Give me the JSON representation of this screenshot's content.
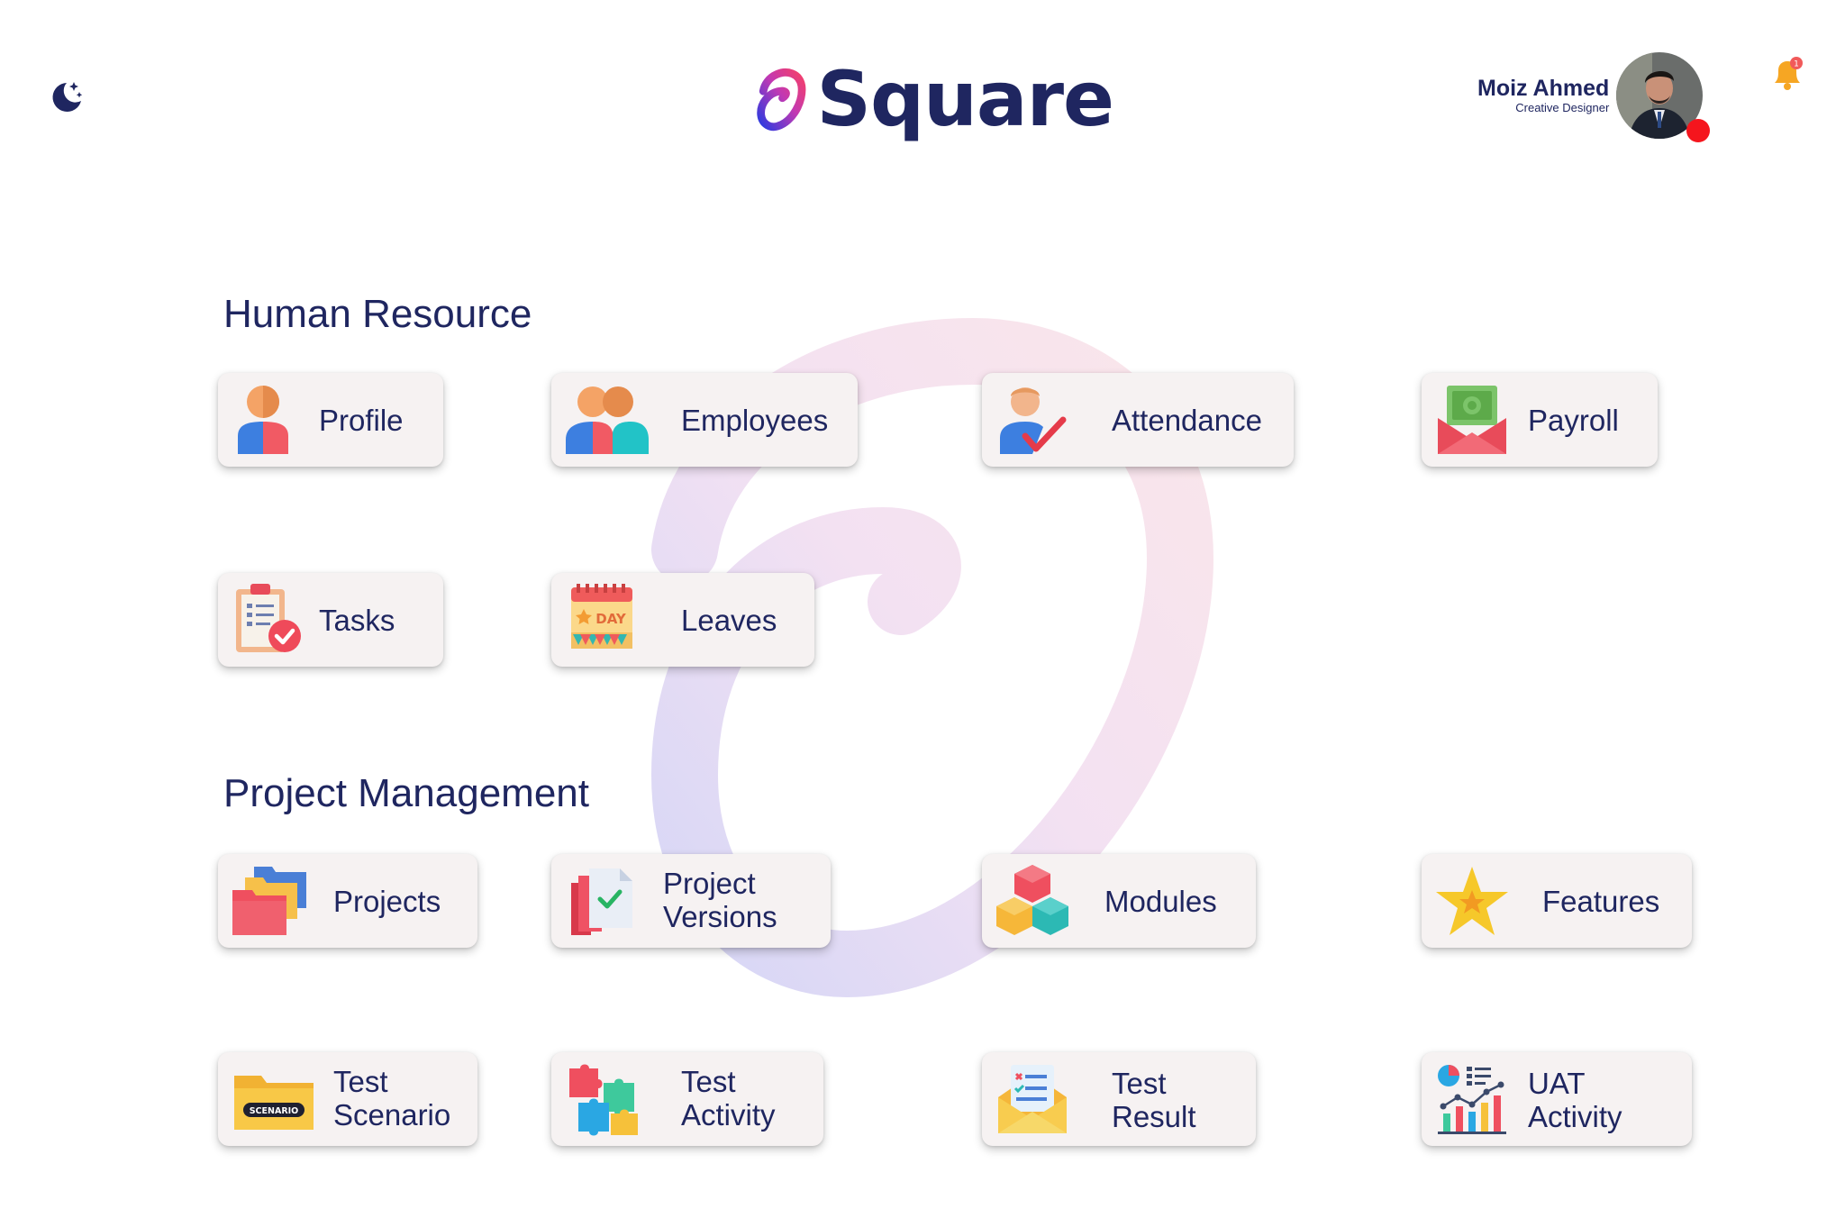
{
  "app": {
    "logo_text": "Square"
  },
  "user": {
    "name": "Moiz Ahmed",
    "role": "Creative Designer",
    "notification_count": "1"
  },
  "sections": {
    "hr": {
      "title": "Human Resource",
      "items": {
        "profile": {
          "label": "Profile",
          "icon": "user-icon"
        },
        "employees": {
          "label": "Employees",
          "icon": "users-icon"
        },
        "attendance": {
          "label": "Attendance",
          "icon": "attendance-check-icon"
        },
        "payroll": {
          "label": "Payroll",
          "icon": "money-envelope-icon"
        },
        "tasks": {
          "label": "Tasks",
          "icon": "clipboard-check-icon"
        },
        "leaves": {
          "label": "Leaves",
          "icon": "calendar-day-icon",
          "icon_text": "DAY"
        }
      }
    },
    "pm": {
      "title": "Project Management",
      "items": {
        "projects": {
          "label": "Projects",
          "icon": "folders-icon"
        },
        "project_versions": {
          "line1": "Project",
          "line2": "Versions",
          "icon": "documents-check-icon"
        },
        "modules": {
          "label": "Modules",
          "icon": "cubes-icon"
        },
        "features": {
          "label": "Features",
          "icon": "star-icon"
        },
        "test_scenario": {
          "line1": "Test",
          "line2": "Scenario",
          "icon": "scenario-folder-icon",
          "icon_text": "SCENARIO"
        },
        "test_activity": {
          "line1": "Test",
          "line2": "Activity",
          "icon": "puzzle-icon"
        },
        "test_result": {
          "line1": "Test",
          "line2": "Result",
          "icon": "result-envelope-icon"
        },
        "uat_activity": {
          "line1": "UAT",
          "line2": "Activity",
          "icon": "analytics-chart-icon"
        }
      }
    }
  },
  "colors": {
    "brand_navy": "#1f2660",
    "card_bg": "#f6f2f2",
    "status_red": "#f5151d",
    "bell_orange": "#f6a623"
  }
}
